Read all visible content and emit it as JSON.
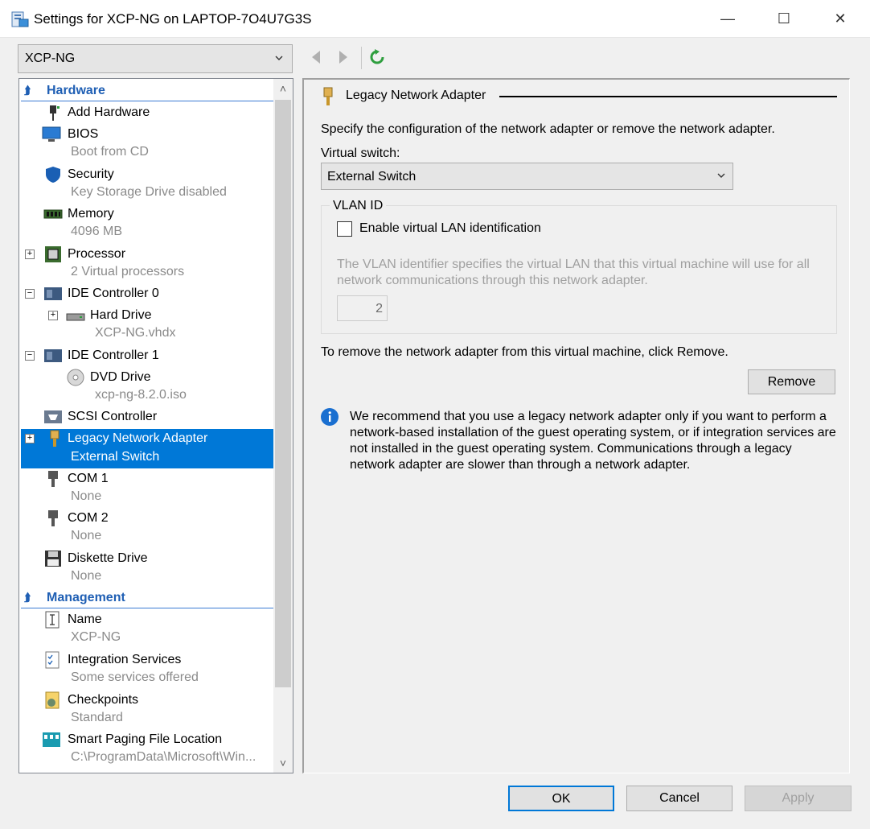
{
  "window": {
    "title": "Settings for XCP-NG on LAPTOP-7O4U7G3S"
  },
  "vm_selector": {
    "value": "XCP-NG"
  },
  "tree": {
    "sections": [
      {
        "label": "Hardware"
      },
      {
        "label": "Management"
      }
    ],
    "items": [
      {
        "label": "Add Hardware",
        "sub": ""
      },
      {
        "label": "BIOS",
        "sub": "Boot from CD"
      },
      {
        "label": "Security",
        "sub": "Key Storage Drive disabled"
      },
      {
        "label": "Memory",
        "sub": "4096 MB"
      },
      {
        "label": "Processor",
        "sub": "2 Virtual processors"
      },
      {
        "label": "IDE Controller 0",
        "sub": ""
      },
      {
        "label": "Hard Drive",
        "sub": "XCP-NG.vhdx"
      },
      {
        "label": "IDE Controller 1",
        "sub": ""
      },
      {
        "label": "DVD Drive",
        "sub": "xcp-ng-8.2.0.iso"
      },
      {
        "label": "SCSI Controller",
        "sub": ""
      },
      {
        "label": "Legacy Network Adapter",
        "sub": "External Switch"
      },
      {
        "label": "COM 1",
        "sub": "None"
      },
      {
        "label": "COM 2",
        "sub": "None"
      },
      {
        "label": "Diskette Drive",
        "sub": "None"
      },
      {
        "label": "Name",
        "sub": "XCP-NG"
      },
      {
        "label": "Integration Services",
        "sub": "Some services offered"
      },
      {
        "label": "Checkpoints",
        "sub": "Standard"
      },
      {
        "label": "Smart Paging File Location",
        "sub": "C:\\ProgramData\\Microsoft\\Win..."
      }
    ]
  },
  "detail": {
    "group_title": "Legacy Network Adapter",
    "intro": "Specify the configuration of the network adapter or remove the network adapter.",
    "switch_label": "Virtual switch:",
    "switch_value": "External Switch",
    "vlan_legend": "VLAN ID",
    "vlan_checkbox_label": "Enable virtual LAN identification",
    "vlan_desc_1": "The VLAN identifier specifies the virtual LAN that this virtual machine will use for all",
    "vlan_desc_2": "network communications through this network adapter.",
    "vlan_value": "2",
    "remove_text": "To remove the network adapter from this virtual machine, click Remove.",
    "remove_button": "Remove",
    "info_text": "We recommend that you use a legacy network adapter only if you want to perform a network-based installation of the guest operating system, or if integration services are not installed in the guest operating system. Communications through a legacy network adapter are slower than through a network adapter."
  },
  "footer": {
    "ok": "OK",
    "cancel": "Cancel",
    "apply": "Apply"
  },
  "colors": {
    "accent": "#0078d7",
    "section_header": "#1f5fb4"
  }
}
